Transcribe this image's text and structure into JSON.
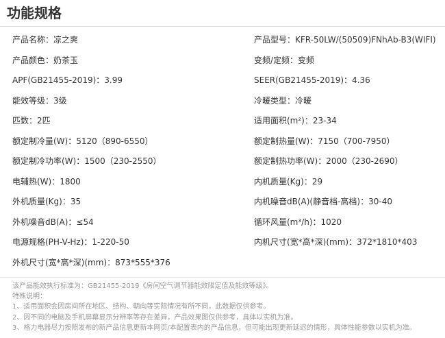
{
  "title": "功能规格",
  "specs": [
    "产品名称：凉之爽",
    "产品型号：KFR-50LW/(50509)FNhAb-B3(WIFI)",
    "产品颜色：奶茶玉",
    "变频/定频：变频",
    "APF(GB21455-2019)：3.99",
    "SEER(GB21455-2019)：4.36",
    "能效等级：3级",
    "冷暖类型：冷暖",
    "匹数：2匹",
    "适用面积(m²)：23-34",
    "额定制冷量(W)：5120（890-6550）",
    "额定制热量(W)：7150（700-7950）",
    "额定制冷功率(W)：1500（230-2550）",
    "额定制热功率(W)：2000（230-2690）",
    "电辅热(W)：1800",
    "内机质量(Kg)：29",
    "外机质量(Kg)：35",
    "内机噪音dB(A)(静音档-高档)：30-40",
    "外机噪音dB(A)：≤54",
    "循环风量(m³/h)：1020",
    "电源规格(PH-V-Hz)：1-220-50",
    "内机尺寸(宽*高*深)(mm)：372*1810*403",
    "外机尺寸(宽*高*深)(mm)：873*555*376"
  ],
  "notes": [
    "该产品能效执行标准为：GB21455-2019《房间空气调节器能效限定值及能效等级》。",
    "特殊说明：",
    "1、适用面积会因房间所在地区、结构、朝向等实际情况有所不同，此数据仅供参考。",
    "2、因不同的电脑及手机屏幕显示分辨率等存在差异，产品效果图仅供参考，具体以实机为准。",
    "3、格力电器尽力按照发布的新产品信息更新本网页/本配置表内的产品信息，但可能出现更新延迟的情形，具体性能参数以实机为准。"
  ]
}
